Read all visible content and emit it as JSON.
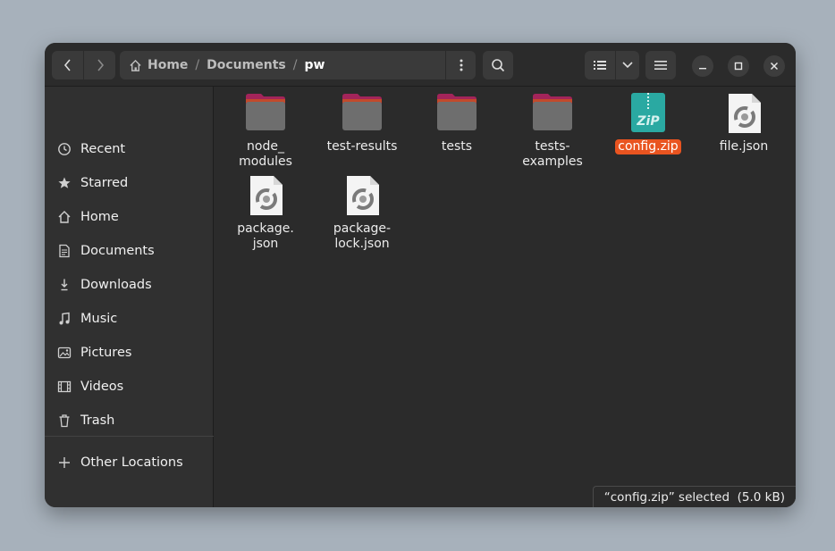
{
  "path": {
    "crumbs": [
      "Home",
      "Documents",
      "pw"
    ],
    "separator": "/"
  },
  "icons": {
    "back": "chevron-left-icon",
    "forward": "chevron-right-icon",
    "home": "home-icon",
    "path_menu": "vertical-dots-icon",
    "search": "search-icon",
    "view_list": "list-view-icon",
    "view_dropdown": "chevron-down-icon",
    "main_menu": "hamburger-menu-icon",
    "minimize": "minimize-icon",
    "maximize": "maximize-icon",
    "close": "close-icon"
  },
  "sidebar": {
    "items": [
      {
        "label": "Recent",
        "icon": "clock-icon"
      },
      {
        "label": "Starred",
        "icon": "star-icon"
      },
      {
        "label": "Home",
        "icon": "home-icon"
      },
      {
        "label": "Documents",
        "icon": "document-icon"
      },
      {
        "label": "Downloads",
        "icon": "download-icon"
      },
      {
        "label": "Music",
        "icon": "music-note-icon"
      },
      {
        "label": "Pictures",
        "icon": "picture-icon"
      },
      {
        "label": "Videos",
        "icon": "film-icon"
      },
      {
        "label": "Trash",
        "icon": "trash-icon"
      }
    ],
    "other_locations": {
      "label": "Other Locations",
      "icon": "plus-icon"
    }
  },
  "files": [
    {
      "name": "node_\nmodules",
      "type": "folder"
    },
    {
      "name": "test-results",
      "type": "folder"
    },
    {
      "name": "tests",
      "type": "folder"
    },
    {
      "name": "tests-\nexamples",
      "type": "folder"
    },
    {
      "name": "config.zip",
      "type": "zip",
      "selected": true,
      "badge": "ZiP"
    },
    {
      "name": "file.json",
      "type": "json"
    },
    {
      "name": "package.\njson",
      "type": "json"
    },
    {
      "name": "package-\nlock.json",
      "type": "json"
    }
  ],
  "status": "“config.zip” selected  (5.0 kB)",
  "colors": {
    "accent": "#e95420",
    "folder_top": "#a3245a",
    "folder_body": "#6e6e6e",
    "zip": "#2aa9a2"
  }
}
